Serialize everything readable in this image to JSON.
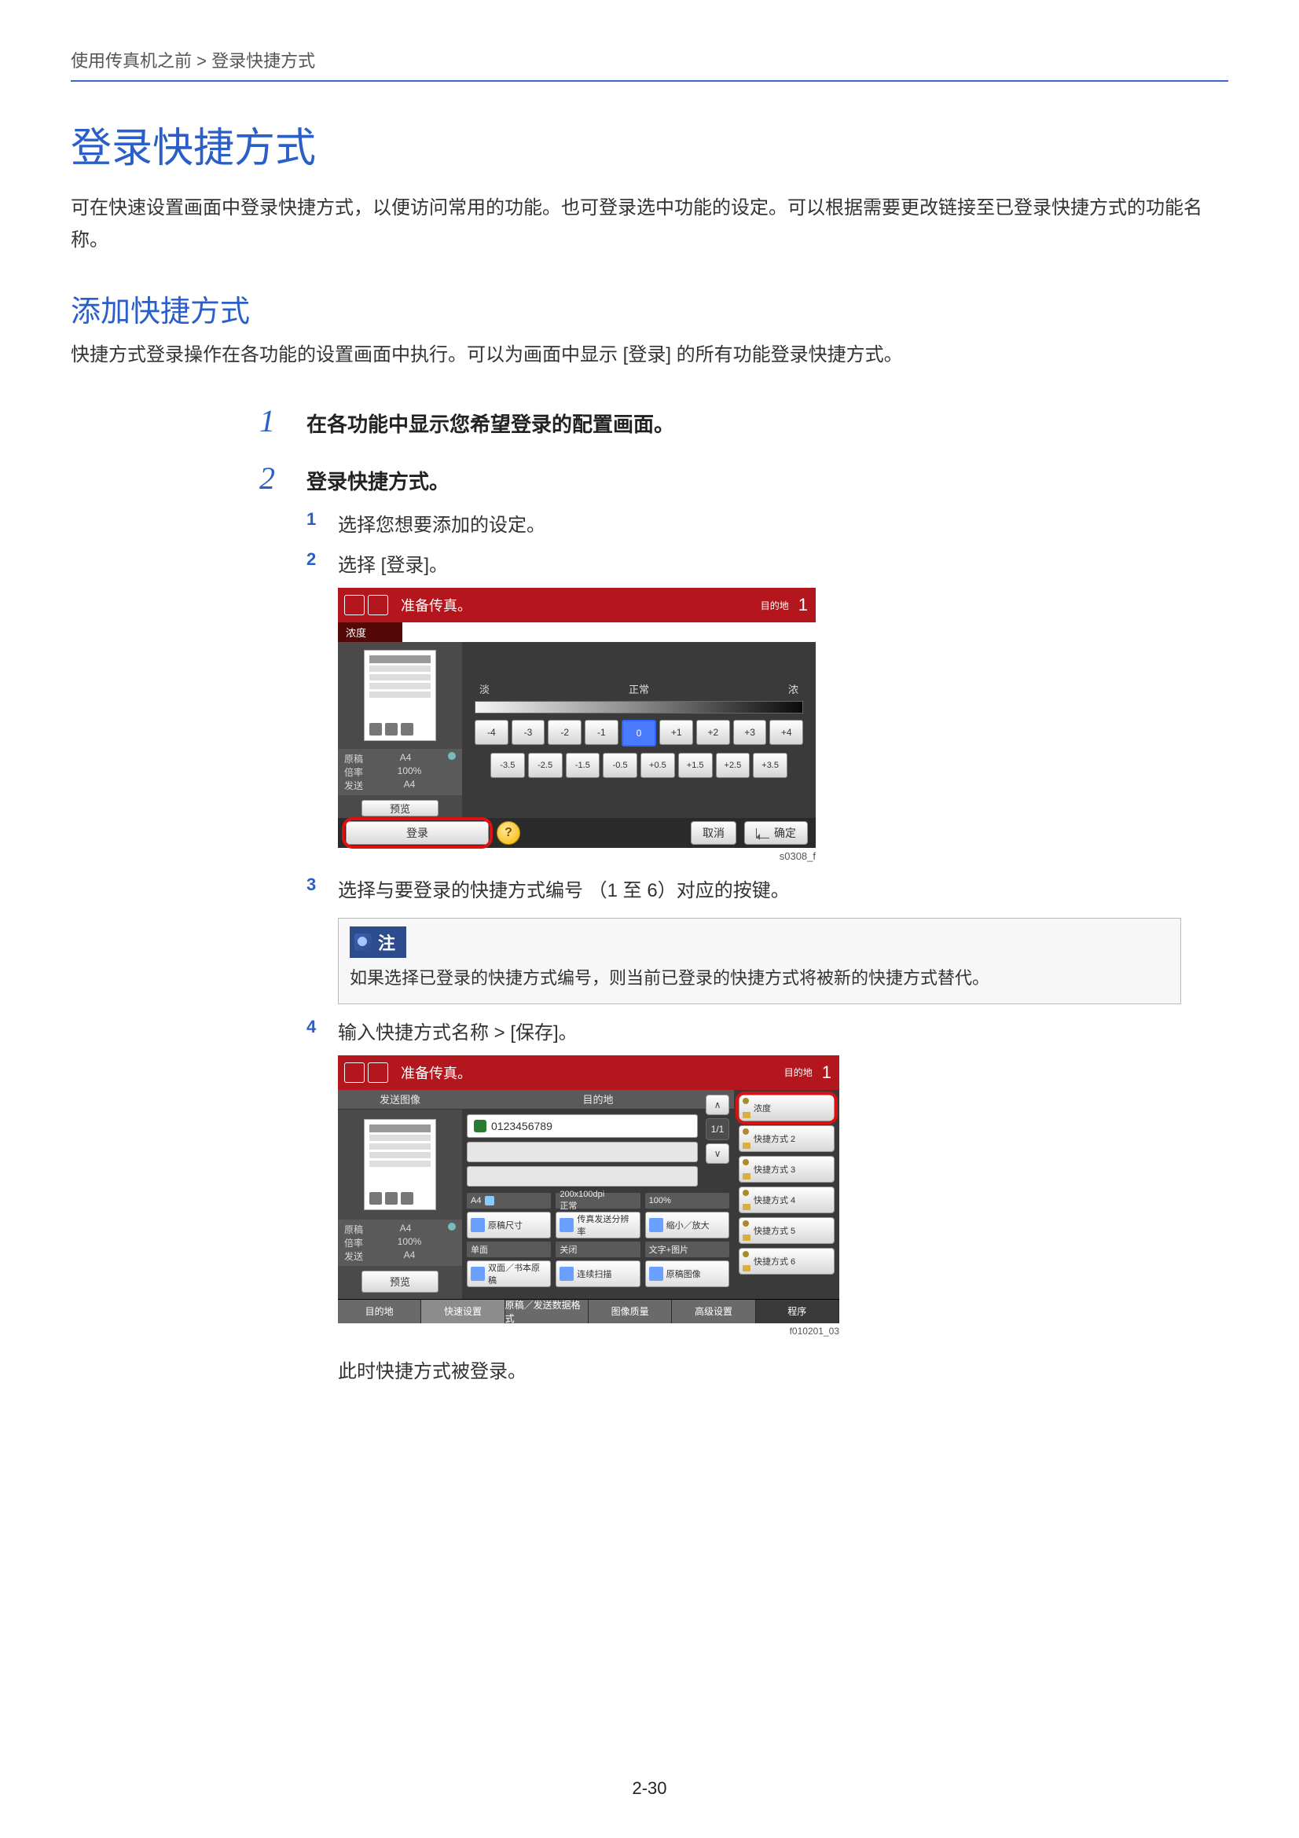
{
  "breadcrumb": "使用传真机之前 > 登录快捷方式",
  "title": "登录快捷方式",
  "lead": "可在快速设置画面中登录快捷方式，以便访问常用的功能。也可登录选中功能的设定。可以根据需要更改链接至已登录快捷方式的功能名称。",
  "subtitle": "添加快捷方式",
  "para": "快捷方式登录操作在各功能的设置画面中执行。可以为画面中显示 [登录] 的所有功能登录快捷方式。",
  "step1": {
    "num": "1",
    "title": "在各功能中显示您希望登录的配置画面。"
  },
  "step2": {
    "num": "2",
    "title": "登录快捷方式。",
    "sub1": {
      "num": "1",
      "text": "选择您想要添加的设定。"
    },
    "sub2": {
      "num": "2",
      "text": "选择 [登录]。"
    },
    "sub3": {
      "num": "3",
      "text": "选择与要登录的快捷方式编号 （1 至 6）对应的按键。"
    },
    "sub4": {
      "num": "4",
      "text": "输入快捷方式名称 > [保存]。"
    },
    "after": "此时快捷方式被登录。"
  },
  "note": {
    "label": "注",
    "body": "如果选择已登录的快捷方式编号，则当前已登录的快捷方式将被新的快捷方式替代。"
  },
  "mock1": {
    "ready": "准备传真。",
    "destLabel": "目的地",
    "destNum": "1",
    "subbar": "浓度",
    "meta": {
      "r1a": "原稿",
      "r1b": "A4",
      "r2a": "倍率",
      "r2b": "100%",
      "r3a": "发送",
      "r3b": "A4"
    },
    "preview": "预览",
    "densLeft": "淡",
    "densMid": "正常",
    "densRight": "浓",
    "row1": [
      "-4",
      "-3",
      "-2",
      "-1",
      "0",
      "+1",
      "+2",
      "+3",
      "+4"
    ],
    "row2": [
      "-3.5",
      "-2.5",
      "-1.5",
      "-0.5",
      "+0.5",
      "+1.5",
      "+2.5",
      "+3.5"
    ],
    "shortcut": "登录",
    "cancel": "取消",
    "ok": "确定",
    "ref": "s0308_f"
  },
  "mock2": {
    "ready": "准备传真。",
    "destLabel": "目的地",
    "destNum": "1",
    "sendImage": "发送图像",
    "destTab": "目的地",
    "destValue": "0123456789",
    "pager": "1/1",
    "meta": {
      "r1a": "原稿",
      "r1b": "A4",
      "r2a": "倍率",
      "r2b": "100%",
      "r3a": "发送",
      "r3b": "A4",
      "preview": "预览"
    },
    "shortcuts": [
      "浓度",
      "快捷方式 2",
      "快捷方式 3",
      "快捷方式 4",
      "快捷方式 5",
      "快捷方式 6"
    ],
    "fcol1": {
      "head": "A4",
      "b1": "原稿尺寸",
      "b2l": "单面",
      "b2": "双面／书本原稿"
    },
    "fcol2": {
      "head": "200x100dpi\n正常",
      "b1": "传真发送分辨率",
      "b2l": "关闭",
      "b2": "连续扫描"
    },
    "fcol3": {
      "head": "100%",
      "b1": "缩小／放大",
      "b2l": "文字+图片",
      "b2": "原稿图像"
    },
    "tabs": [
      "目的地",
      "快速设置",
      "原稿／发送数据格式",
      "图像质量",
      "高级设置",
      "程序"
    ],
    "ref": "f010201_03"
  },
  "pagenum": "2-30"
}
